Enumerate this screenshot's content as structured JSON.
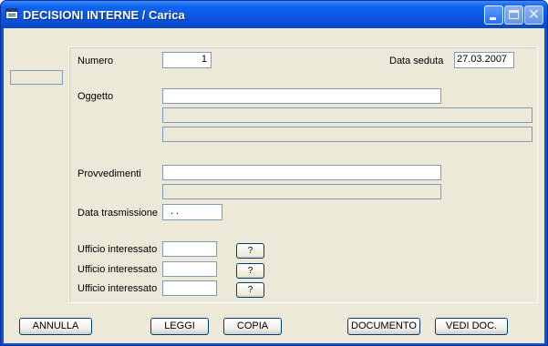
{
  "window": {
    "title": "DECISIONI INTERNE / Carica",
    "colors": {
      "titlebar": "#0a55e0",
      "client_bg": "#ece9d8",
      "field_border": "#7f9db9"
    },
    "controls": {
      "minimize_icon": "minimize-icon",
      "maximize_icon": "maximize-icon",
      "close_icon": "close-icon",
      "close_glyph": "✕"
    }
  },
  "form": {
    "numero": {
      "label": "Numero",
      "value": "1"
    },
    "data_seduta": {
      "label": "Data seduta",
      "value": "27.03.2007"
    },
    "oggetto": {
      "label": "Oggetto",
      "value": ""
    },
    "provvedimenti": {
      "label": "Provvedimenti",
      "value": ""
    },
    "data_trasmissione": {
      "label": "Data trasmissione",
      "value": ". ."
    },
    "uffici": [
      {
        "label": "Ufficio interessato",
        "value": "",
        "lookup": "?"
      },
      {
        "label": "Ufficio interessato",
        "value": "",
        "lookup": "?"
      },
      {
        "label": "Ufficio interessato",
        "value": "",
        "lookup": "?"
      }
    ]
  },
  "buttons": {
    "annulla": "ANNULLA",
    "leggi": "LEGGI",
    "copia": "COPIA",
    "documento": "DOCUMENTO",
    "vedi_doc": "VEDI DOC."
  }
}
